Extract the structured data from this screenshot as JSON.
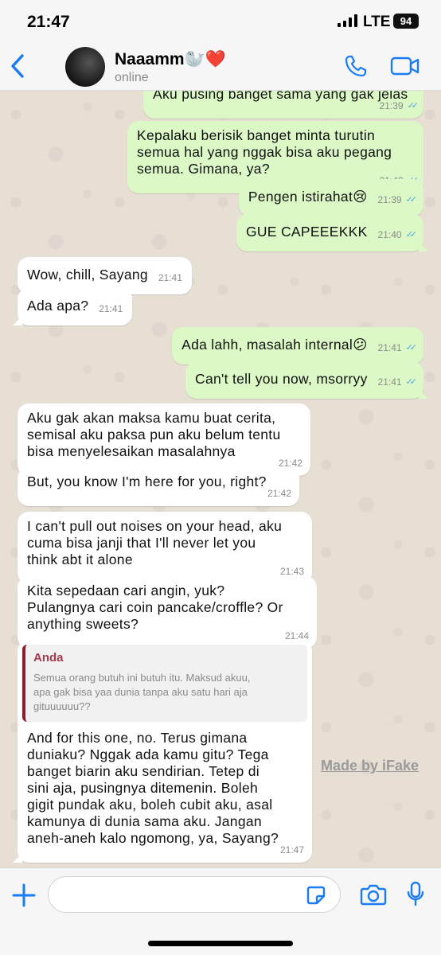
{
  "status_bar": {
    "time": "21:47",
    "network": "LTE",
    "battery": "94"
  },
  "header": {
    "contact_name": "Naaamm🦭❤️",
    "contact_status": "online"
  },
  "messages": [
    {
      "dir": "out",
      "text": "Aku pusing banget sama yang gak jelas",
      "time": "21:39"
    },
    {
      "dir": "out",
      "text": "Kepalaku berisik banget minta turutin\nsemua hal yang nggak bisa aku pegang\nsemua. Gimana, ya?",
      "time": "21:40"
    },
    {
      "dir": "out",
      "text": "Pengen istirahat😢",
      "time": "21:39"
    },
    {
      "dir": "out",
      "text": "GUE CAPEEEKKK",
      "time": "21:40"
    },
    {
      "dir": "in",
      "text": "Wow, chill, Sayang",
      "time": "21:41"
    },
    {
      "dir": "in",
      "text": "Ada apa?",
      "time": "21:41"
    },
    {
      "dir": "out",
      "text": "Ada lahh, masalah internal😕",
      "time": "21:41"
    },
    {
      "dir": "out",
      "text": "Can't tell you now, msorryy",
      "time": "21:41"
    },
    {
      "dir": "in",
      "text": "Aku gak akan maksa kamu buat cerita,\nsemisal aku paksa pun aku belum tentu\nbisa menyelesaikan masalahnya",
      "time": "21:42"
    },
    {
      "dir": "in",
      "text": "But, you know I'm here for you, right?",
      "time": "21:42"
    },
    {
      "dir": "in",
      "text": "I can't pull out noises on your head, aku\ncuma bisa janji that I'll never let you\nthink abt it alone",
      "time": "21:43"
    },
    {
      "dir": "in",
      "text": "Kita sepedaan cari angin, yuk?\nPulangnya cari coin pancake/croffle? Or\nanything sweets?",
      "time": "21:44"
    },
    {
      "dir": "in",
      "text": "And for this one, no. Terus gimana\nduniaku? Nggak ada kamu gitu? Tega\nbanget biarin aku sendirian. Tetep di\nsini aja, pusingnya ditemenin. Boleh\ngigit pundak aku, boleh cubit aku, asal\nkamunya di dunia sama aku. Jangan\naneh-aneh kalo ngomong, ya, Sayang?",
      "time": "21:47",
      "quote": {
        "author": "Anda",
        "text": "Semua orang butuh ini butuh itu. Maksud akuu,\napa gak bisa yaa dunia tanpa aku satu hari aja\ngituuuuuu??"
      }
    }
  ],
  "watermark": "Made by iFake",
  "input": {
    "placeholder": ""
  },
  "icons": {
    "back": "chevron-left-icon",
    "call": "phone-icon",
    "video": "video-camera-icon",
    "plus": "plus-icon",
    "sticker": "sticker-icon",
    "camera": "camera-icon",
    "mic": "microphone-icon"
  },
  "colors": {
    "accent": "#1a7cf5",
    "outgoing_bubble": "#dcf8c6",
    "incoming_bubble": "#ffffff",
    "read_ticks": "#4fa8e0"
  }
}
